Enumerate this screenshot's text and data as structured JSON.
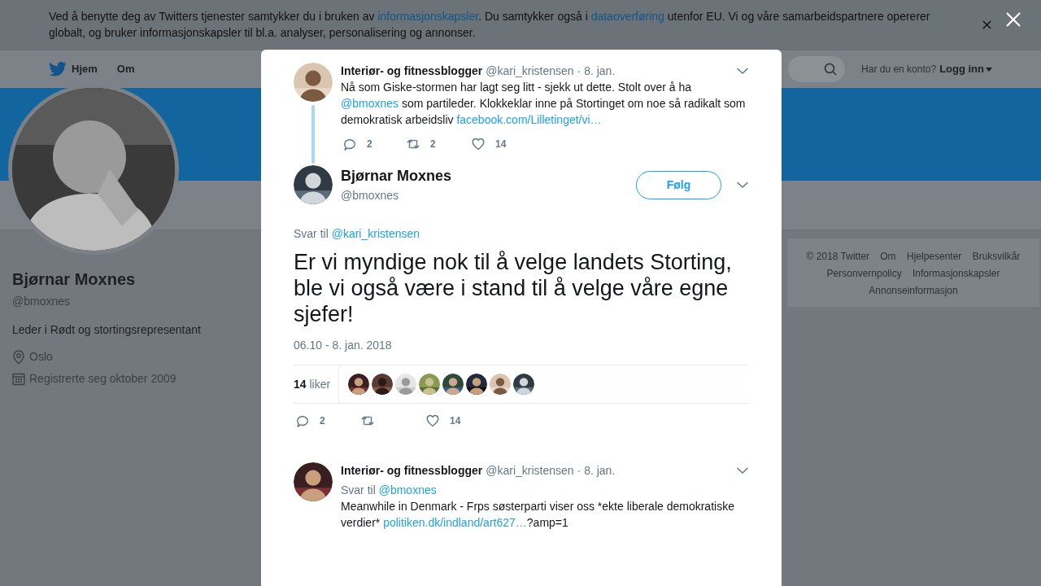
{
  "cookie_banner": {
    "segments": [
      {
        "kind": "text",
        "text": "Ved å benytte deg av Twitters tjenester samtykker du i bruken av "
      },
      {
        "kind": "link",
        "text": "informasjonskapsler"
      },
      {
        "kind": "text",
        "text": ". Du samtykker også i "
      },
      {
        "kind": "link",
        "text": "dataoverføring"
      },
      {
        "kind": "text",
        "text": " utenfor EU. Vi og våre samarbeidspartnere opererer globalt, og bruker informasjonskapsler til bl.a. analyser, personalisering og annonser."
      }
    ]
  },
  "navbar": {
    "items": [
      {
        "label": "Hjem",
        "kind": "bird"
      },
      {
        "label": "Om",
        "kind": "plain"
      }
    ],
    "account_prompt": "Har du en konto?",
    "login": "Logg inn"
  },
  "profile": {
    "name": "Bjørnar Moxnes",
    "handle": "@bmoxnes",
    "bio": "Leder i Rødt og stortingsrepresentant",
    "details": [
      {
        "kind": "location",
        "text": "Oslo"
      },
      {
        "kind": "calendar",
        "text": "Registrerte seg oktober 2009"
      }
    ]
  },
  "footer_links": [
    "© 2018 Twitter",
    "Om",
    "Hjelpesenter",
    "Bruksvilkår",
    "Personvernpolicy",
    "Informasjonskapsler",
    "Annonseinformasjon"
  ],
  "modal": {
    "context_tweet": {
      "name": "Interiør- og fitnessblogger",
      "handle": "@kari_kristensen",
      "time": "· 8. jan.",
      "text": [
        {
          "kind": "text",
          "text": "Nå som Giske-stormen har lagt seg litt - sjekk ut dette. Stolt over å ha "
        },
        {
          "kind": "link",
          "text": "@bmoxnes"
        },
        {
          "kind": "text",
          "text": " som partileder. Klokkeklar inne på Stortinget om noe så radikalt som demokratisk arbeidsliv "
        },
        {
          "kind": "link",
          "text": "facebook.com/Lilletinget/vi…"
        }
      ],
      "replies": "2",
      "retweets": "2",
      "likes": "14"
    },
    "main_tweet": {
      "name": "Bjørnar Moxnes",
      "handle": "@bmoxnes",
      "follow": "Følg",
      "reply_label": "Svar til",
      "reply_to": "@kari_kristensen",
      "text": "Er vi myndige nok til å velge landets Storting, ble vi også være i stand til å velge våre egne sjefer!",
      "timestamp": "06.10 - 8. jan. 2018",
      "like_count": "14",
      "like_label": "liker",
      "replies": "2",
      "likes": "14"
    },
    "reply_tweet": {
      "name": "Interiør- og fitnessblogger",
      "handle": "@kari_kristensen",
      "time": "· 8. jan.",
      "reply_label": "Svar til",
      "reply_to": "@bmoxnes",
      "text": [
        {
          "kind": "text",
          "text": "Meanwhile in Denmark - Frps søsterparti viser oss *ekte liberale demokratiske verdier* "
        },
        {
          "kind": "link",
          "text": "politiken.dk/indland/art627…"
        },
        {
          "kind": "text",
          "text": "?amp=1"
        }
      ]
    }
  }
}
